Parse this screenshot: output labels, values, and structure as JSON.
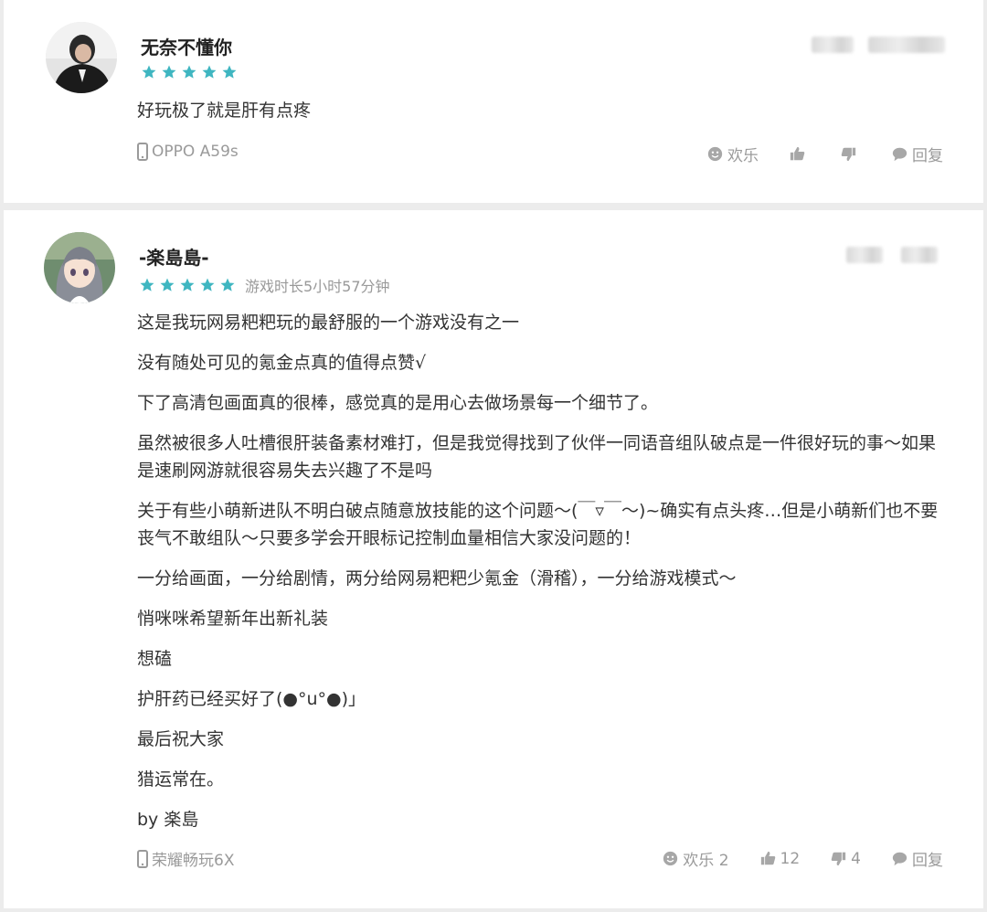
{
  "reviews": [
    {
      "username": "无奈不懂你",
      "stars": 5,
      "content": [
        "好玩极了就是肝有点疼"
      ],
      "device": "OPPO A59s",
      "actions": {
        "funny": "欢乐",
        "like": "",
        "dislike": "",
        "reply": "回复"
      }
    },
    {
      "username": "-楽島島-",
      "stars": 5,
      "playtime": "游戏时长5小时57分钟",
      "content": [
        "这是我玩网易粑粑玩的最舒服的一个游戏没有之一",
        "没有随处可见的氪金点真的值得点赞√",
        "下了高清包画面真的很棒，感觉真的是用心去做场景每一个细节了。",
        "虽然被很多人吐槽很肝装备素材难打，但是我觉得找到了伙伴一同语音组队破点是一件很好玩的事～如果是速刷网游就很容易失去兴趣了不是吗",
        "关于有些小萌新进队不明白破点随意放技能的这个问题～(￣▿￣～)~确实有点头疼…但是小萌新们也不要丧气不敢组队～只要多学会开眼标记控制血量相信大家没问题的！",
        "一分给画面，一分给剧情，两分给网易粑粑少氪金（滑稽），一分给游戏模式～",
        "悄咪咪希望新年出新礼装",
        "想磕",
        "护肝药已经买好了(●°u°●)」",
        "最后祝大家",
        "猎运常在。",
        "by 楽島"
      ],
      "device": "荣耀畅玩6X",
      "actions": {
        "funny": "欢乐 2",
        "like": "12",
        "dislike": "4",
        "reply": "回复"
      }
    }
  ],
  "colors": {
    "star": "#3fb6c1",
    "muted": "#9a9a9a",
    "text": "#333333"
  },
  "icons": [
    "phone-icon",
    "smiley-icon",
    "thumbs-up-icon",
    "thumbs-down-icon",
    "comment-icon",
    "star-icon"
  ]
}
